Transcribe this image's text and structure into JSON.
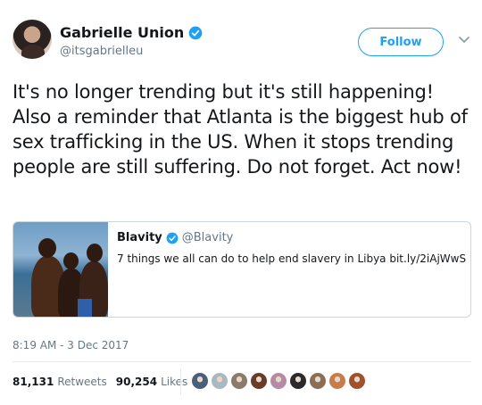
{
  "author": {
    "name": "Gabrielle Union",
    "handle": "@itsgabrielleu",
    "verified": true
  },
  "follow_label": "Follow",
  "tweet_text": "It's no longer trending but it's still happening! Also a reminder that Atlanta is the biggest hub of sex trafficking in the US. When it stops trending people are still suffering. Do not forget. Act now!",
  "quoted_tweet": {
    "name": "Blavity",
    "handle": "@Blavity",
    "verified": true,
    "text": "7 things we all can do to help end slavery in Libya bit.ly/2iAjWwS"
  },
  "timestamp": "8:19 AM - 3 Dec 2017",
  "stats": {
    "retweets_count": "81,131",
    "retweets_label": "Retweets",
    "likes_count": "90,254",
    "likes_label": "Likes"
  },
  "liker_avatar_colors": [
    "#4a5f7a",
    "#aab8c2",
    "#8c7b6a",
    "#6b3b2a",
    "#b58ba3",
    "#2b2b2b",
    "#8a6f55",
    "#c77d4a",
    "#a0522d"
  ],
  "colors": {
    "accent": "#1da1f2",
    "secondary_text": "#657786",
    "primary_text": "#14171a"
  }
}
